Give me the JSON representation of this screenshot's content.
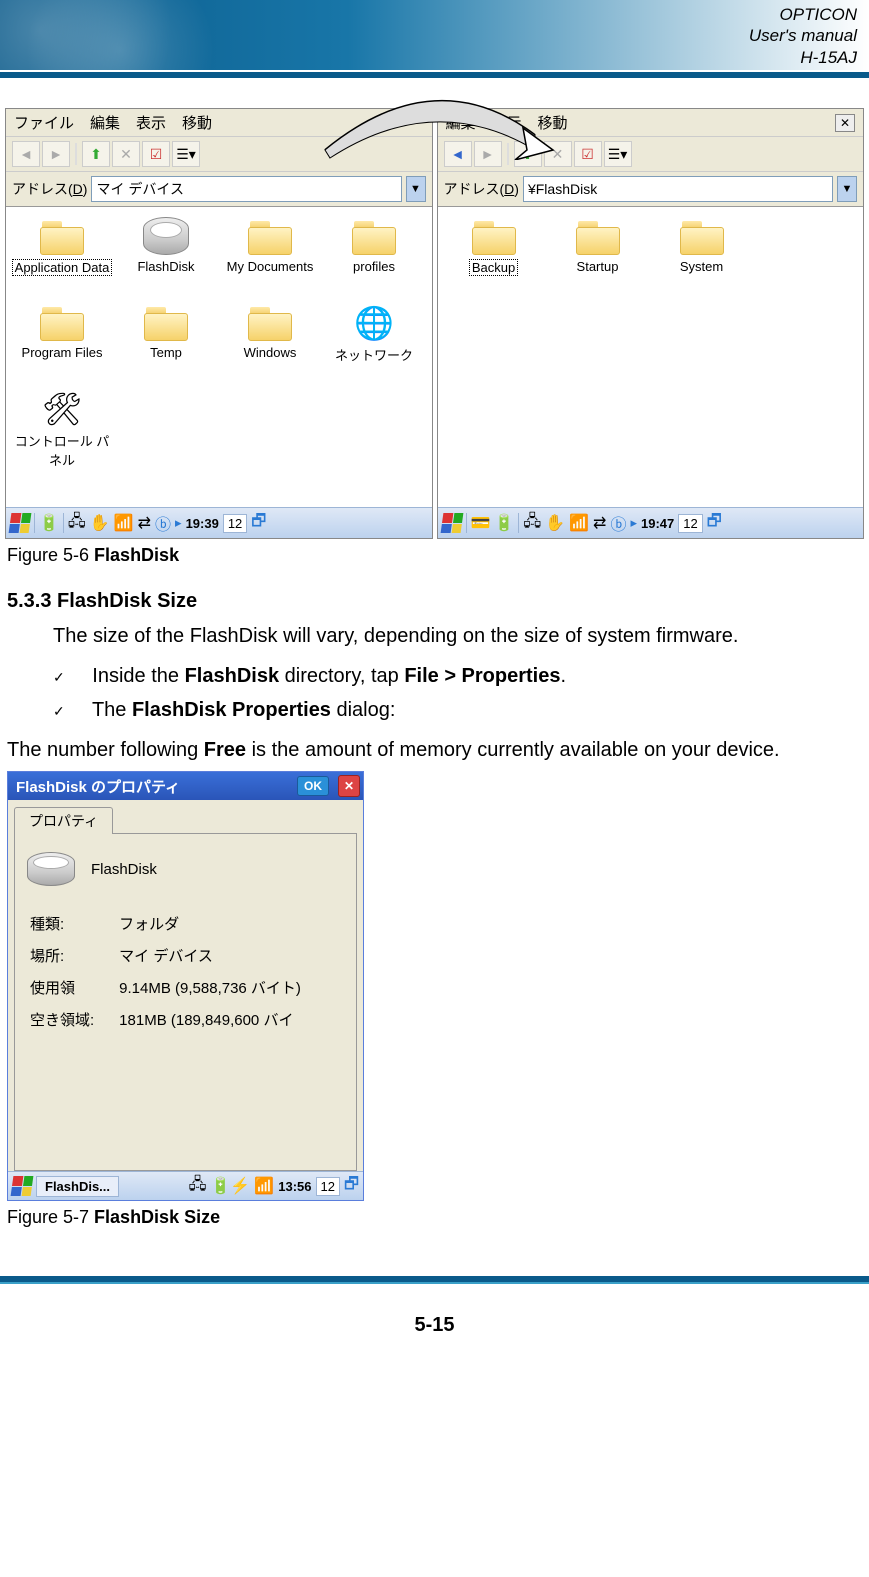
{
  "header": {
    "line1": "OPTICON",
    "line2": "User's manual",
    "line3": "H-15AJ"
  },
  "explorer_left": {
    "menu": [
      "ファイル",
      "編集",
      "表示",
      "移動"
    ],
    "address_label_pre": "アドレス(",
    "address_label_u": "D",
    "address_label_post": ")",
    "address_value": "マイ デバイス",
    "items": [
      {
        "label": "Application Data",
        "type": "folder",
        "boxed": true
      },
      {
        "label": "FlashDisk",
        "type": "drive"
      },
      {
        "label": "My Documents",
        "type": "folder"
      },
      {
        "label": "profiles",
        "type": "folder"
      },
      {
        "label": "Program Files",
        "type": "folder"
      },
      {
        "label": "Temp",
        "type": "folder"
      },
      {
        "label": "Windows",
        "type": "folder"
      },
      {
        "label": "ネットワーク",
        "type": "net"
      },
      {
        "label": "コントロール パネル",
        "type": "cp"
      }
    ],
    "taskbar_time": "19:39",
    "taskbar_date": "12"
  },
  "explorer_right": {
    "menu": [
      "編集",
      "表示",
      "移動"
    ],
    "address_label_pre": "アドレス(",
    "address_label_u": "D",
    "address_label_post": ")",
    "address_value": "¥FlashDisk",
    "items": [
      {
        "label": "Backup",
        "type": "folder",
        "boxed": true
      },
      {
        "label": "Startup",
        "type": "folder"
      },
      {
        "label": "System",
        "type": "folder"
      }
    ],
    "taskbar_time": "19:47",
    "taskbar_date": "12"
  },
  "caption1_pre": "Figure 5-6 ",
  "caption1_bold": "FlashDisk",
  "section": {
    "heading": "5.3.3 FlashDisk Size",
    "para1": "The size of the FlashDisk will vary, depending on the size of system firmware.",
    "bullet1_pre": "Inside the ",
    "bullet1_b1": "FlashDisk",
    "bullet1_mid": " directory, tap ",
    "bullet1_b2": "File > Properties",
    "bullet1_post": ".",
    "bullet2_pre": "The ",
    "bullet2_b1": "FlashDisk Properties",
    "bullet2_post": " dialog:",
    "para2_pre": "The number following ",
    "para2_bold": "Free",
    "para2_post": " is the amount of memory currently available on your device."
  },
  "props": {
    "title": "FlashDisk のプロパティ",
    "ok": "OK",
    "tab": "プロパティ",
    "name": "FlashDisk",
    "rows": [
      {
        "k": "種類:",
        "v": "フォルダ"
      },
      {
        "k": "場所:",
        "v": "マイ デバイス"
      },
      {
        "k": "使用領",
        "v": "9.14MB (9,588,736 バイト)"
      },
      {
        "k": "空き領域:",
        "v": "181MB (189,849,600 バイ"
      }
    ],
    "task_label": "FlashDis...",
    "task_time": "13:56",
    "task_date": "12"
  },
  "caption2_pre": "Figure 5-7 ",
  "caption2_bold": "FlashDisk Size",
  "page_number": "5-15"
}
